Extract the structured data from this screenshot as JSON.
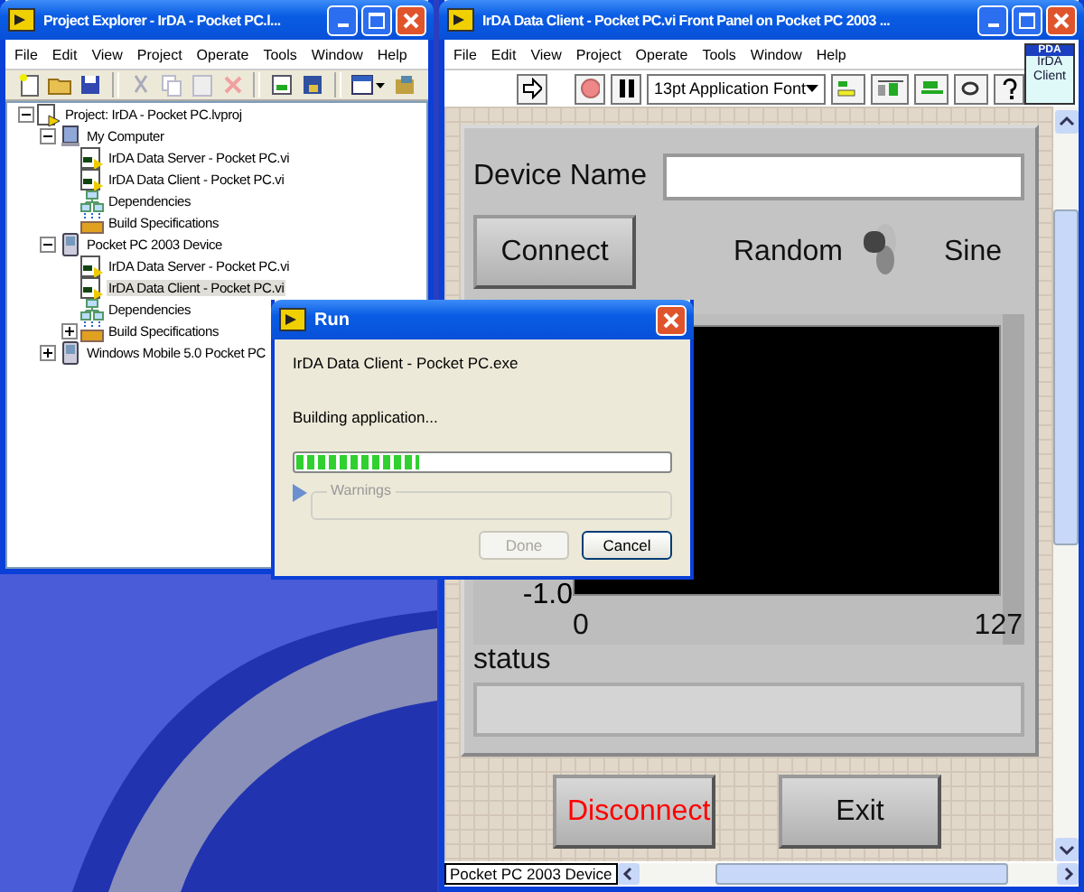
{
  "project_explorer": {
    "title": "Project Explorer - IrDA - Pocket PC.l...",
    "menu": [
      "File",
      "Edit",
      "View",
      "Project",
      "Operate",
      "Tools",
      "Window",
      "Help"
    ],
    "tree": [
      {
        "label": "Project: IrDA - Pocket PC.lvproj",
        "kind": "project",
        "expanded": true,
        "selected": false,
        "children": [
          {
            "label": "My Computer",
            "kind": "computer",
            "expanded": true,
            "selected": false,
            "children": [
              {
                "label": "IrDA Data Server - Pocket PC.vi",
                "kind": "vi",
                "selected": false
              },
              {
                "label": "IrDA Data Client - Pocket PC.vi",
                "kind": "vi",
                "selected": false
              },
              {
                "label": "Dependencies",
                "kind": "dependencies",
                "selected": false
              },
              {
                "label": "Build Specifications",
                "kind": "build",
                "selected": false
              }
            ]
          },
          {
            "label": "Pocket PC 2003 Device",
            "kind": "device",
            "expanded": true,
            "selected": false,
            "children": [
              {
                "label": "IrDA Data Server - Pocket PC.vi",
                "kind": "vi",
                "selected": false
              },
              {
                "label": "IrDA Data Client - Pocket PC.vi",
                "kind": "vi",
                "selected": true
              },
              {
                "label": "Dependencies",
                "kind": "dependencies",
                "selected": false
              },
              {
                "label": "Build Specifications",
                "kind": "build",
                "expanded": false,
                "selected": false
              }
            ]
          },
          {
            "label": "Windows Mobile 5.0 Pocket PC",
            "kind": "device",
            "expanded": false,
            "selected": false
          }
        ]
      }
    ]
  },
  "front_panel_window": {
    "title": "IrDA Data Client - Pocket PC.vi Front Panel on Pocket PC 2003 ...",
    "menu": [
      "File",
      "Edit",
      "View",
      "Project",
      "Operate",
      "Tools",
      "Window",
      "Help"
    ],
    "font_selector": "13pt Application Font",
    "vi_icon": {
      "header": "PDA",
      "label": "IrDA Client"
    },
    "panel": {
      "device_name_label": "Device Name",
      "connect_button": "Connect",
      "toggle": {
        "left_label": "Random",
        "right_label": "Sine",
        "on": false
      },
      "graph": {
        "y_tick": "-1.0",
        "x_ticks": [
          "0",
          "127"
        ]
      },
      "status_label": "status"
    },
    "buttons": [
      {
        "label": "Disconnect",
        "kind": "danger"
      },
      {
        "label": "Exit",
        "kind": "plain"
      }
    ],
    "status_bar": "Pocket PC 2003 Device"
  },
  "run_dialog": {
    "title": "Run",
    "file": "IrDA Data Client - Pocket PC.exe",
    "message": "Building application...",
    "progress": {
      "level": 0.33
    },
    "warnings": {
      "label": "Warnings",
      "expanded": false
    },
    "buttons": [
      {
        "label": "Done",
        "disabled": true
      },
      {
        "label": "Cancel",
        "disabled": false
      }
    ]
  }
}
